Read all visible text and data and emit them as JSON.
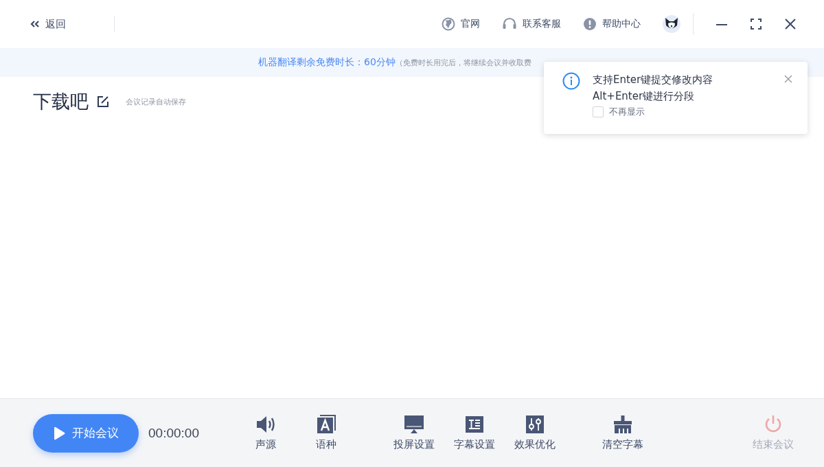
{
  "header": {
    "back": "返回",
    "links": [
      {
        "kind": "globe",
        "label": "官网"
      },
      {
        "kind": "headset",
        "label": "联系客服"
      },
      {
        "kind": "alert",
        "label": "帮助中心"
      }
    ]
  },
  "banner": {
    "text": "机器翻译剩余免费时长：60分钟",
    "note": "（免费时长用完后，将继续会议并收取费"
  },
  "document": {
    "title": "下载吧",
    "autosave": "会议记录自动保存"
  },
  "tip": {
    "lines": [
      "支持Enter键提交修改内容",
      "Alt+Enter键进行分段"
    ],
    "dont_show": {
      "label": "不再显示",
      "checked": false
    }
  },
  "toolbar": {
    "start": "开始会议",
    "timer": "00:00:00",
    "groups": [
      {
        "items": [
          {
            "kind": "speaker",
            "label": "声源"
          },
          {
            "kind": "language",
            "label": "语种"
          }
        ]
      },
      {
        "items": [
          {
            "kind": "screen",
            "label": "投屏设置"
          },
          {
            "kind": "subtitle",
            "label": "字幕设置"
          },
          {
            "kind": "sliders",
            "label": "效果优化"
          }
        ]
      },
      {
        "items": [
          {
            "kind": "broom",
            "label": "清空字幕"
          }
        ]
      }
    ],
    "end": {
      "label": "结束会议",
      "disabled": true
    }
  }
}
